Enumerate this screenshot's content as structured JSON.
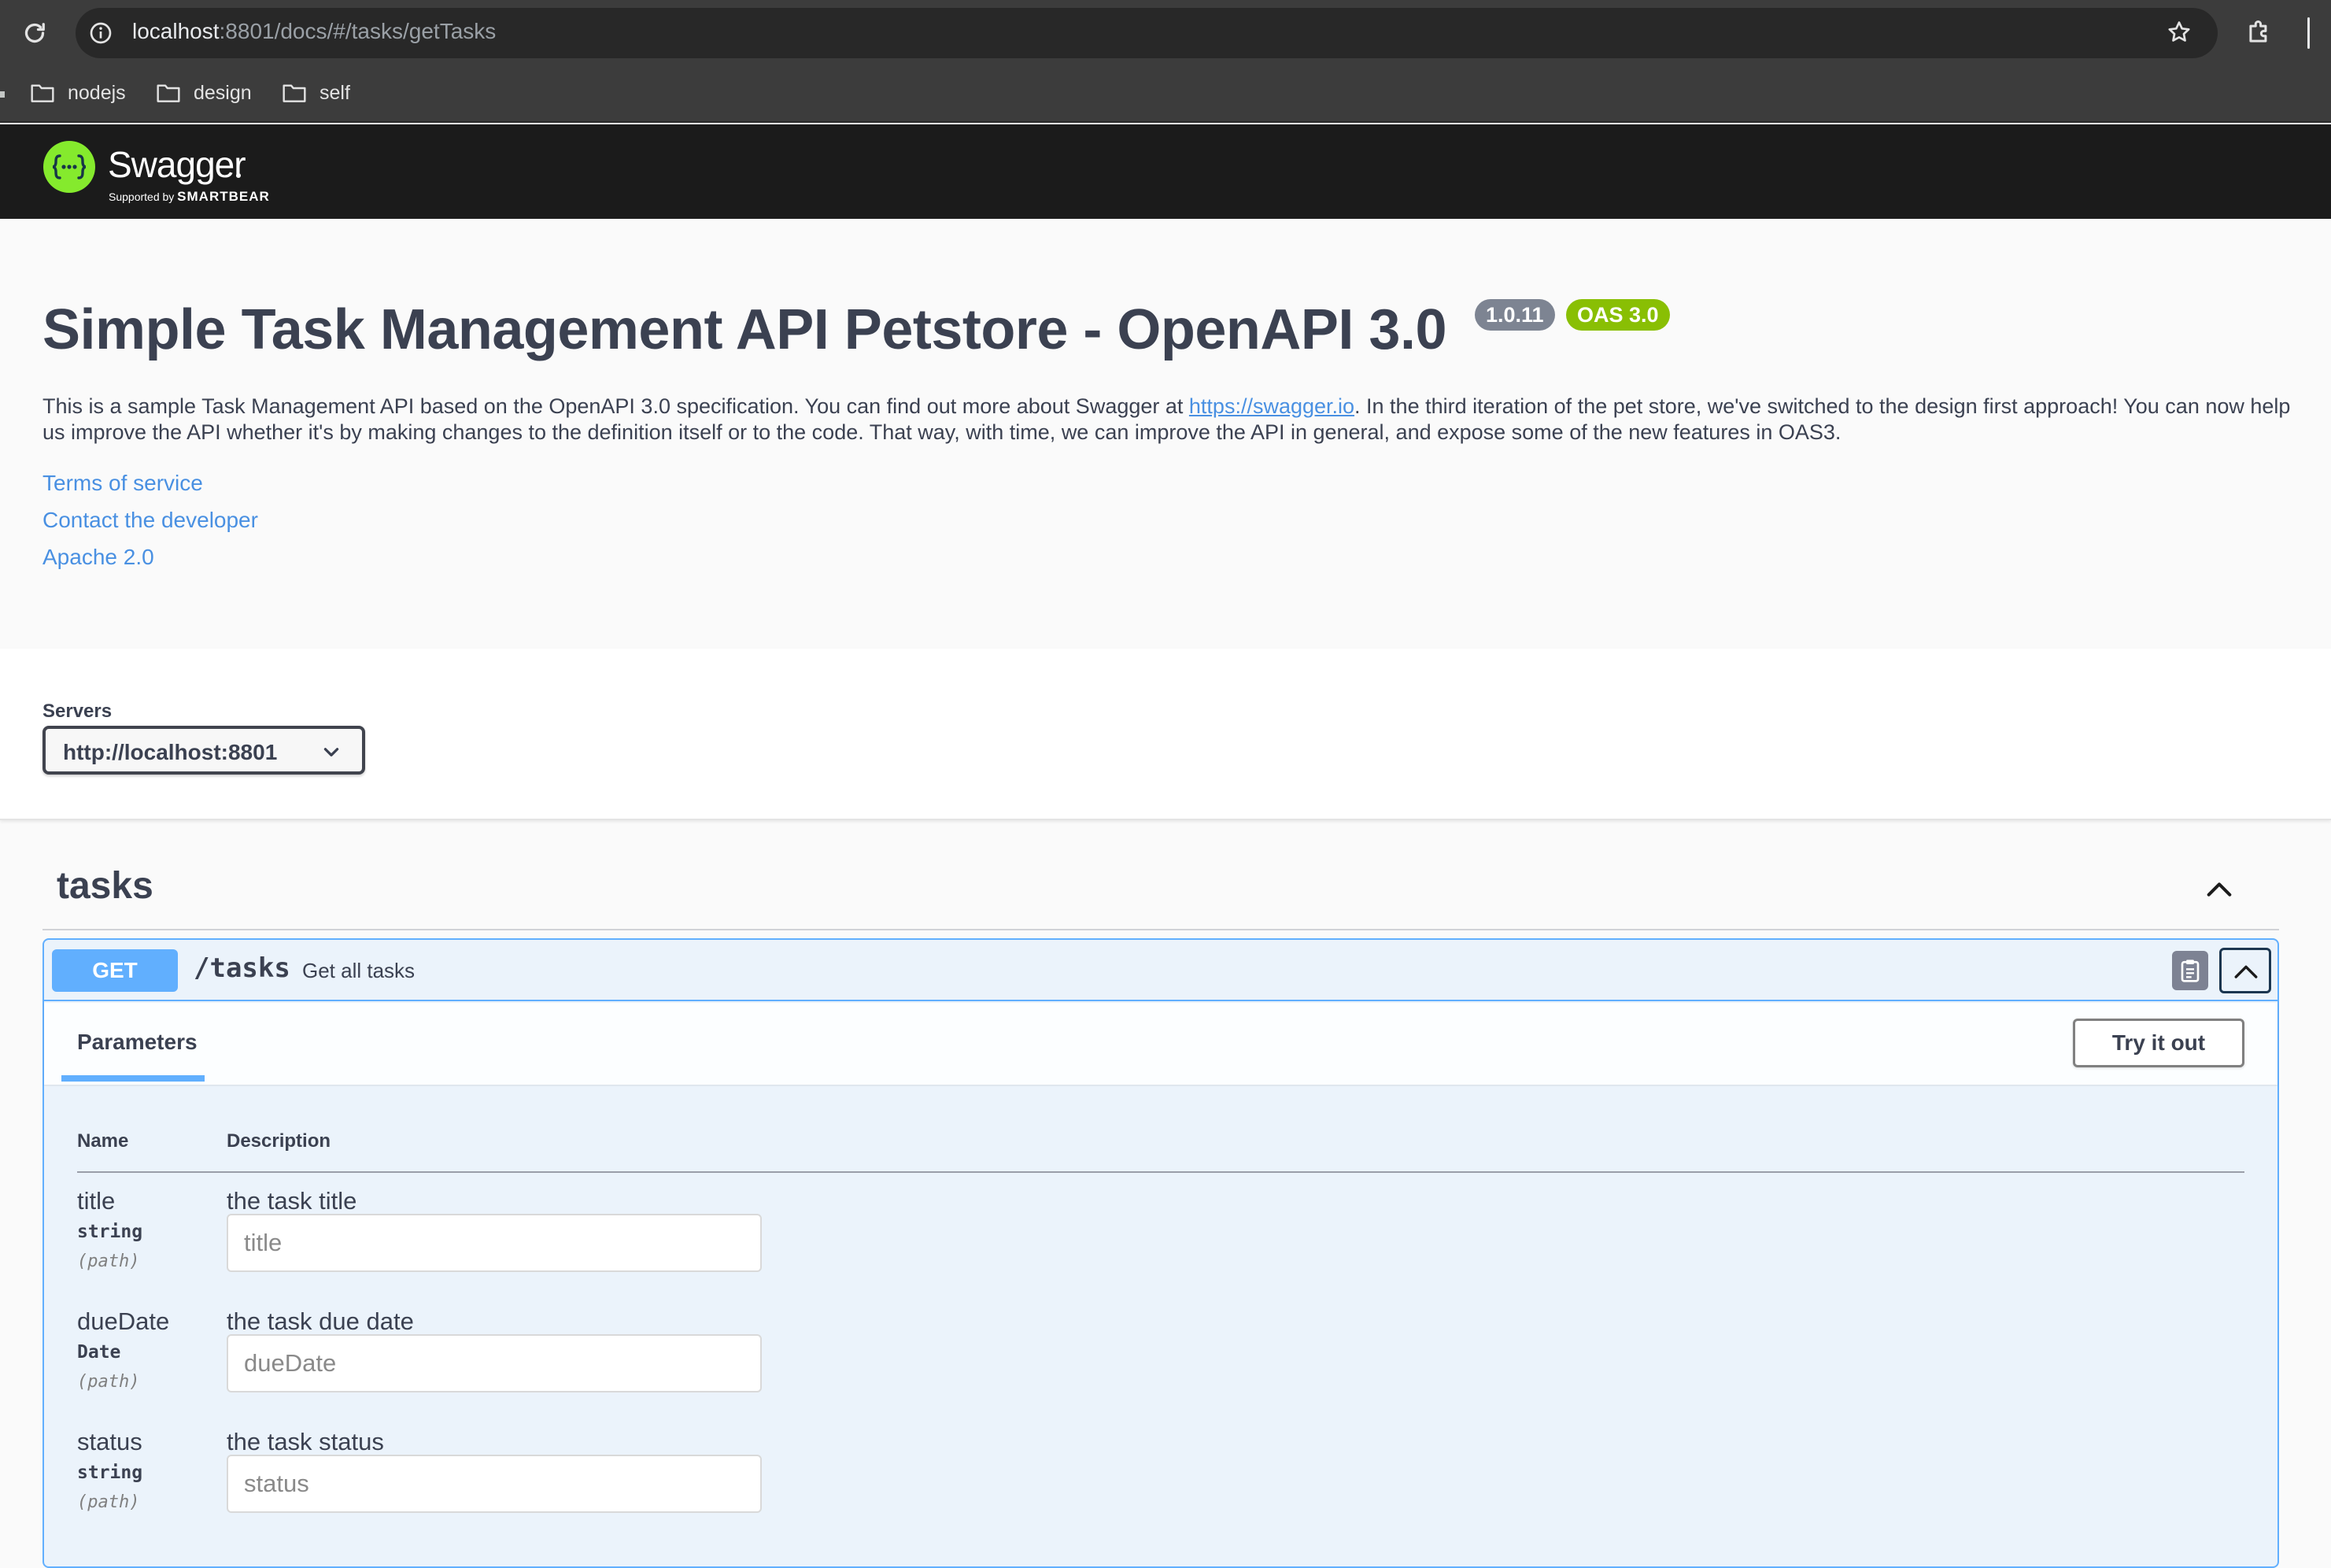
{
  "browser": {
    "url_host": "localhost",
    "url_rest": ":8801/docs/#/tasks/getTasks",
    "bookmarks": [
      {
        "label": "nodejs",
        "icon": "folder-icon"
      },
      {
        "label": "design",
        "icon": "folder-icon"
      },
      {
        "label": "self",
        "icon": "folder-icon"
      }
    ]
  },
  "topbar": {
    "logo_text": "Swagger",
    "logo_sub_prefix": "Supported by ",
    "logo_sub_brand": "SMARTBEAR"
  },
  "info": {
    "title": "Simple Task Management API Petstore - OpenAPI 3.0",
    "version": "1.0.11",
    "oas": "OAS 3.0",
    "description_before": "This is a sample Task Management API based on the OpenAPI 3.0 specification. You can find out more about Swagger at ",
    "description_link": "https://swagger.io",
    "description_after": ". In the third iteration of the pet store, we've switched to the design first approach! You can now help us improve the API whether it's by making changes to the definition itself or to the code. That way, with time, we can improve the API in general, and expose some of the new features in OAS3.",
    "links": [
      "Terms of service",
      "Contact the developer",
      "Apache 2.0"
    ]
  },
  "servers": {
    "label": "Servers",
    "selected": "http://localhost:8801"
  },
  "tag": {
    "name": "tasks",
    "operation": {
      "method": "GET",
      "path": "/tasks",
      "summary": "Get all tasks",
      "tab_label": "Parameters",
      "try_label": "Try it out",
      "col_name": "Name",
      "col_description": "Description",
      "params": [
        {
          "name": "title",
          "type": "string",
          "in": "(path)",
          "description": "the task title",
          "placeholder": "title"
        },
        {
          "name": "dueDate",
          "type": "Date",
          "in": "(path)",
          "description": "the task due date",
          "placeholder": "dueDate"
        },
        {
          "name": "status",
          "type": "string",
          "in": "(path)",
          "description": "the task status",
          "placeholder": "status"
        }
      ]
    }
  },
  "colors": {
    "get_accent": "#61affe",
    "link": "#4990e2",
    "oas_badge": "#89bf04",
    "version_badge": "#7d8492",
    "swagger_green": "#85ea2d"
  }
}
